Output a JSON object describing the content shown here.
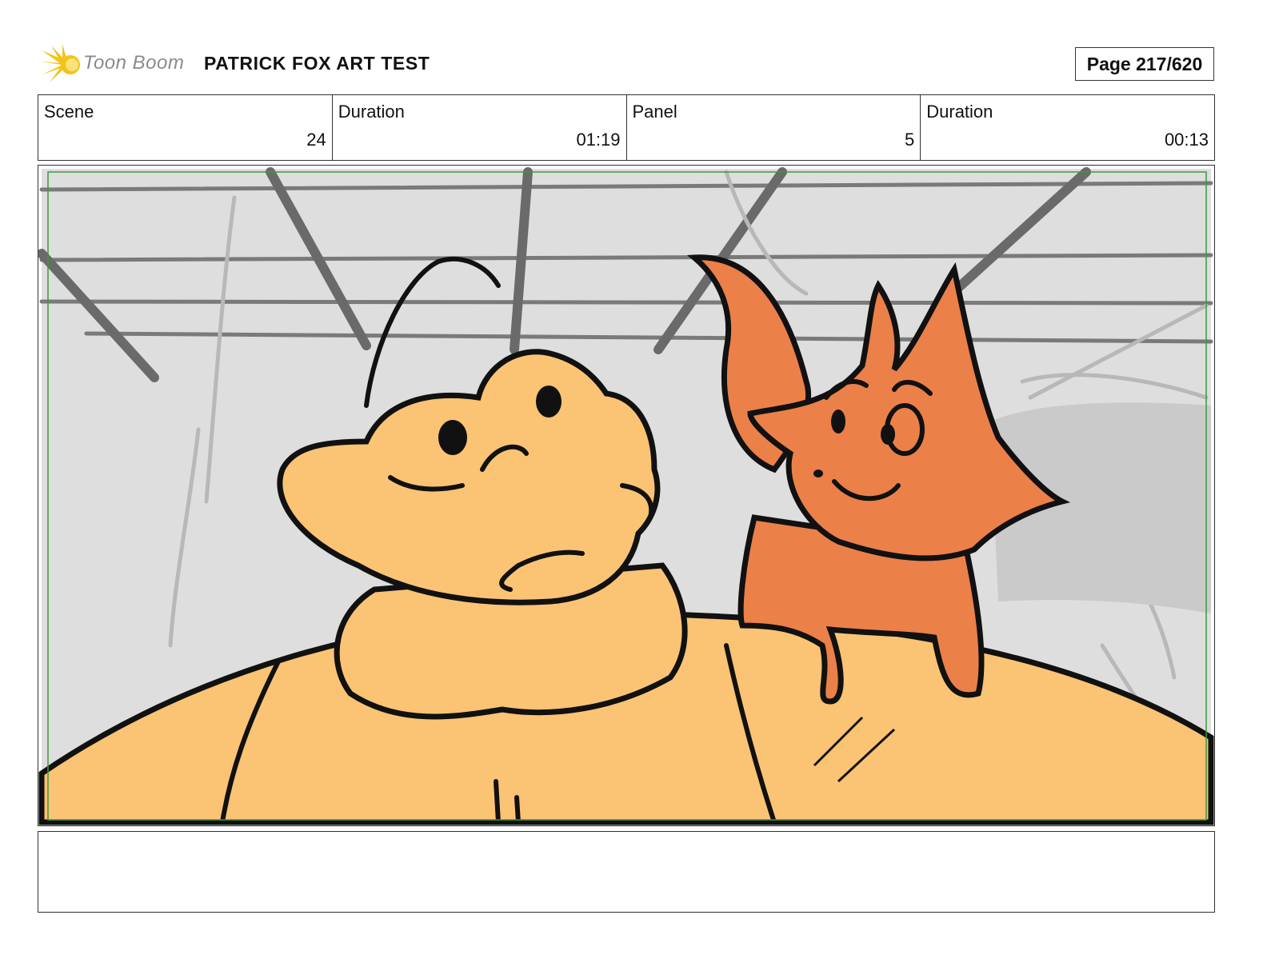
{
  "header": {
    "logo_text": "Toon Boom",
    "project_title": "PATRICK FOX ART TEST",
    "page_label": "Page 217/620"
  },
  "info": {
    "scene_label": "Scene",
    "scene_value": "24",
    "scene_duration_label": "Duration",
    "scene_duration_value": "01:19",
    "panel_label": "Panel",
    "panel_value": "5",
    "panel_duration_label": "Duration",
    "panel_duration_value": "00:13"
  },
  "colors": {
    "frog_fill": "#fbc374",
    "fox_fill": "#ec8049",
    "background_gray": "#dedede",
    "line_gray": "#777777",
    "safe_frame": "#3a9a3a",
    "logo_yellow": "#f2c419"
  },
  "notes": {
    "text": ""
  }
}
